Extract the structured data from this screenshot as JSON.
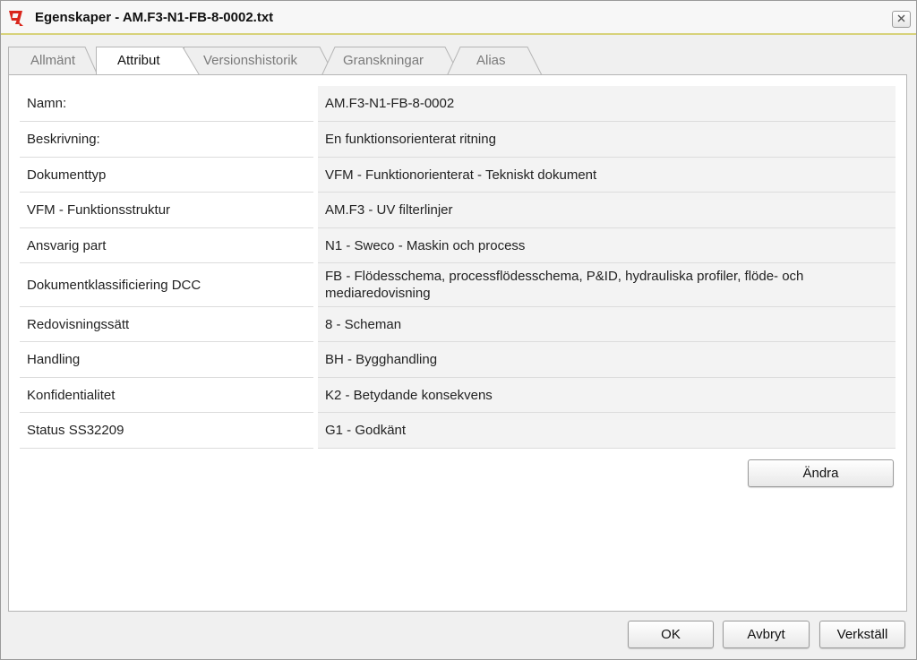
{
  "window": {
    "title": "Egenskaper - AM.F3-N1-FB-8-0002.txt"
  },
  "tabs": [
    {
      "label": "Allmänt",
      "active": false
    },
    {
      "label": "Attribut",
      "active": true
    },
    {
      "label": "Versionshistorik",
      "active": false
    },
    {
      "label": "Granskningar",
      "active": false
    },
    {
      "label": "Alias",
      "active": false
    }
  ],
  "attributes": [
    {
      "name": "Namn:",
      "value": "AM.F3-N1-FB-8-0002"
    },
    {
      "name": "Beskrivning:",
      "value": "En funktionsorienterat ritning"
    },
    {
      "name": "Dokumenttyp",
      "value": "VFM - Funktionorienterat - Tekniskt dokument"
    },
    {
      "name": "VFM - Funktionsstruktur",
      "value": "AM.F3 - UV filterlinjer"
    },
    {
      "name": "Ansvarig part",
      "value": "N1 - Sweco - Maskin och process"
    },
    {
      "name": "Dokumentklassificiering DCC",
      "value": "FB - Flödesschema, processflödesschema, P&ID, hydrauliska profiler, flöde- och mediaredovisning"
    },
    {
      "name": "Redovisningssätt",
      "value": "8 - Scheman"
    },
    {
      "name": "Handling",
      "value": "BH - Bygghandling"
    },
    {
      "name": "Konfidentialitet",
      "value": "K2 - Betydande konsekvens"
    },
    {
      "name": "Status SS32209",
      "value": "G1 - Godkänt"
    }
  ],
  "buttons": {
    "change": "Ändra",
    "ok": "OK",
    "cancel": "Avbryt",
    "apply": "Verkställ"
  },
  "icons": {
    "app": "app-logo-icon",
    "close": "close-icon"
  },
  "colors": {
    "logo_red": "#d9261c",
    "title_underline": "#d7d27a"
  }
}
